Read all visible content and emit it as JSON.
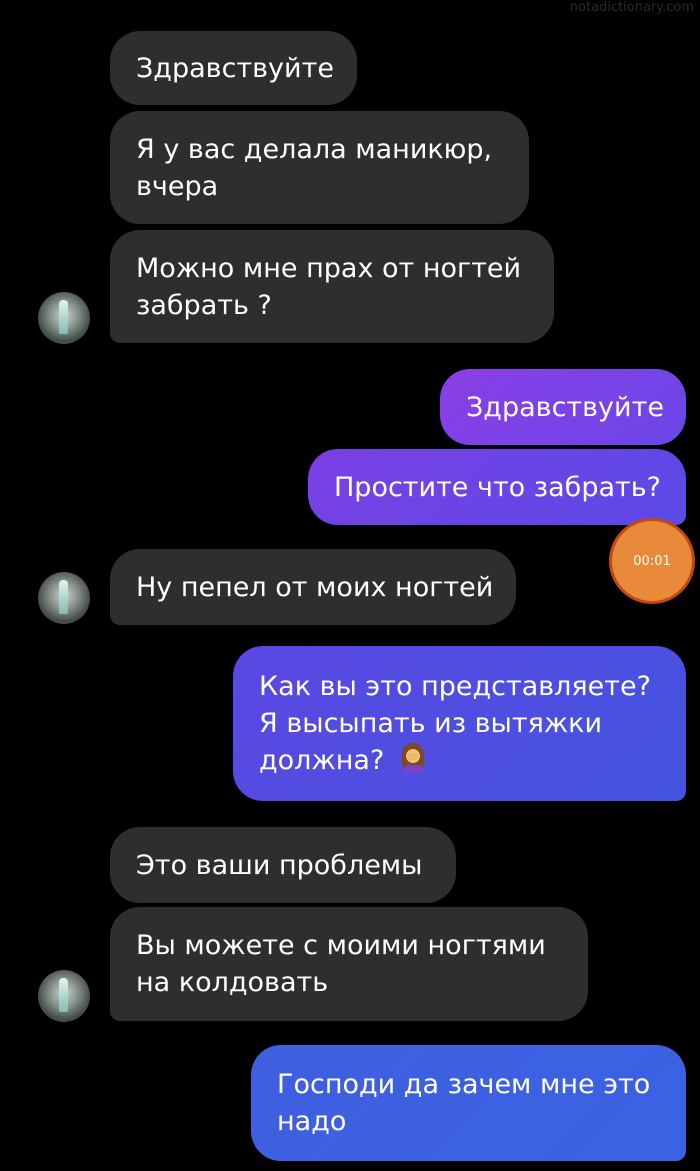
{
  "watermark": "notadictionary.com",
  "timer_label": "00:01",
  "messages": [
    {
      "lines": [
        "Здравствуйте"
      ]
    },
    {
      "lines": [
        "Я у вас делала маникюр,",
        "вчера"
      ]
    },
    {
      "lines": [
        "Можно мне прах от ногтей",
        "забрать ?"
      ]
    },
    {
      "lines": [
        "Здравствуйте"
      ]
    },
    {
      "lines": [
        "Простите что забрать?"
      ]
    },
    {
      "lines": [
        "Ну пепел от моих ногтей"
      ]
    },
    {
      "lines": [
        "Как вы это представляете?",
        "Я высыпать из вытяжки",
        "должна?"
      ]
    },
    {
      "lines": [
        "Это ваши проблемы"
      ]
    },
    {
      "lines": [
        "Вы можете с моими ногтями",
        "на колдовать"
      ]
    },
    {
      "lines": [
        "Господи да зачем мне это",
        "надо"
      ]
    }
  ],
  "colors": {
    "incoming_bubble": "#2e2e2e",
    "outgoing_gradient": [
      "#8a3fe6",
      "#3f5fe0"
    ],
    "timer": "#e88a3a"
  },
  "icons": {
    "avatar": "contact-avatar-photo",
    "emoji": "woman-facepalming-emoji"
  }
}
